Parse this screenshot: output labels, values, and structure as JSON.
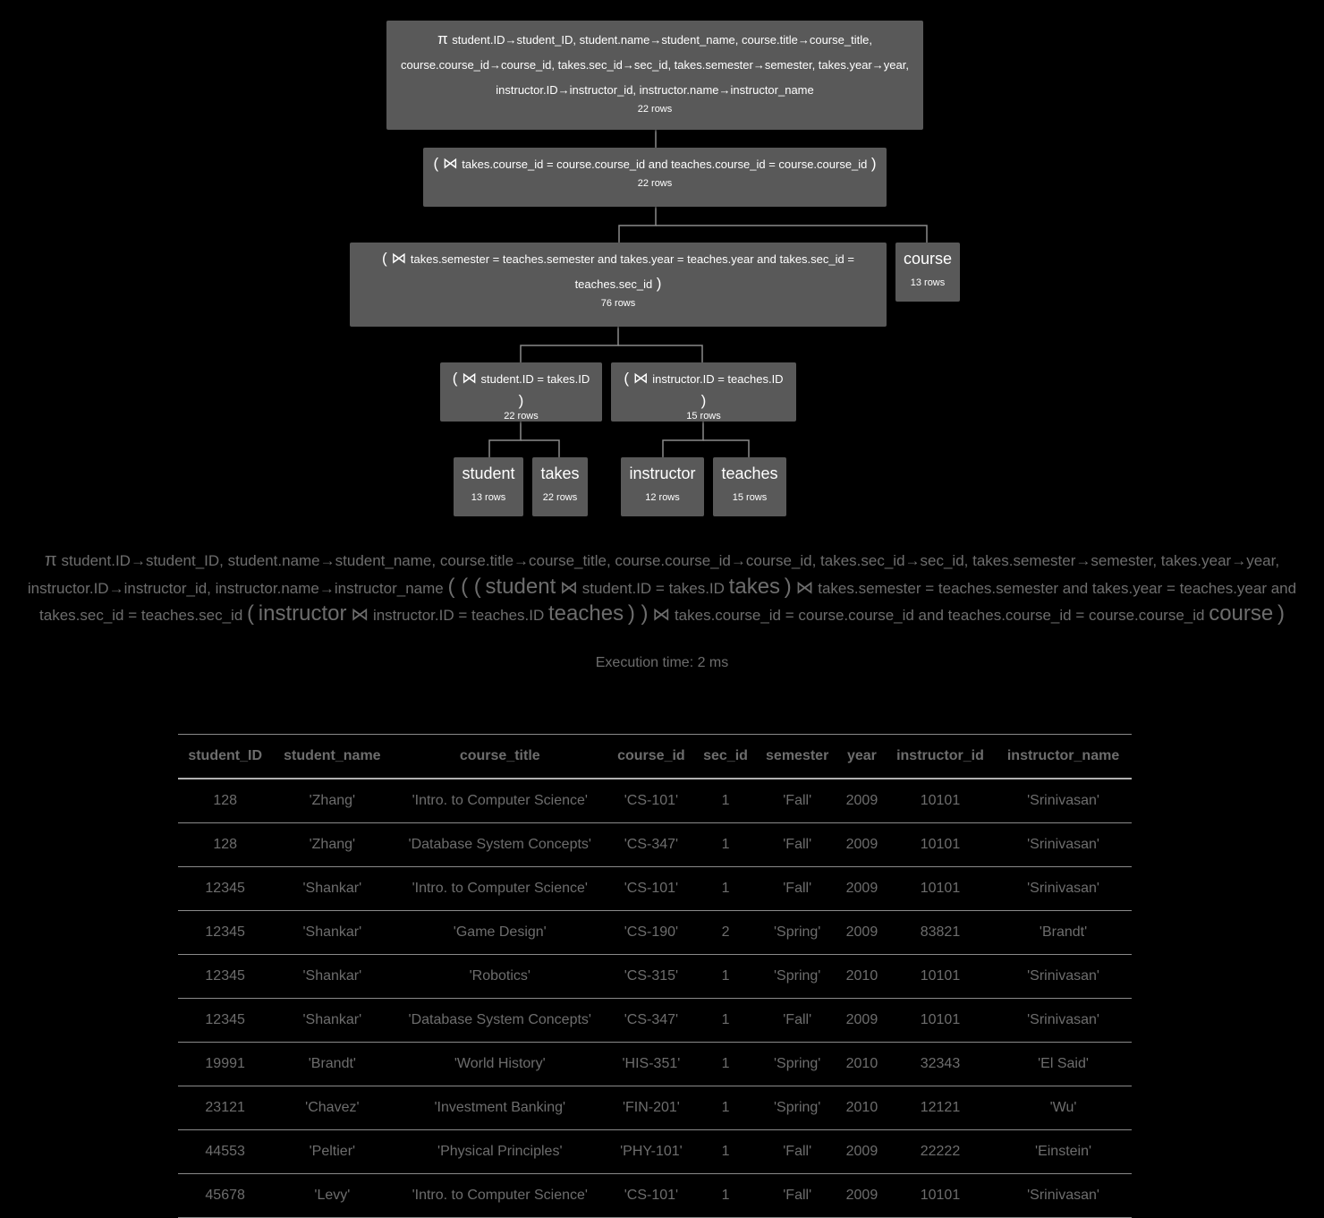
{
  "tree": {
    "projection": {
      "symbol": "π",
      "line1": "student.ID→student_ID, student.name→student_name, course.title→course_title,",
      "line2": "course.course_id→course_id, takes.sec_id→sec_id, takes.semester→semester, takes.year→year,",
      "line3": "instructor.ID→instructor_id, instructor.name→instructor_name",
      "rows": "22 rows"
    },
    "join_course": {
      "open": "( ⋈",
      "cond": "takes.course_id = course.course_id and teaches.course_id = course.course_id",
      "close": ")",
      "rows": "22 rows"
    },
    "join_sem": {
      "open": "( ⋈",
      "cond1": "takes.semester = teaches.semester and takes.year = teaches.year and takes.sec_id =",
      "cond2": "teaches.sec_id",
      "close": ")",
      "rows": "76 rows"
    },
    "course": {
      "name": "course",
      "rows": "13 rows"
    },
    "join_student": {
      "open": "( ⋈",
      "cond": "student.ID = takes.ID",
      "close": ")",
      "rows": "22 rows"
    },
    "join_instructor": {
      "open": "( ⋈",
      "cond": "instructor.ID = teaches.ID",
      "close": ")",
      "rows": "15 rows"
    },
    "student": {
      "name": "student",
      "rows": "13 rows"
    },
    "takes": {
      "name": "takes",
      "rows": "22 rows"
    },
    "instructor": {
      "name": "instructor",
      "rows": "12 rows"
    },
    "teaches": {
      "name": "teaches",
      "rows": "15 rows"
    }
  },
  "expression": {
    "pi": "π",
    "proj": "student.ID→student_ID, student.name→student_name, course.title→course_title, course.course_id→course_id, takes.sec_id→sec_id, takes.semester→semester, takes.year→year, instructor.ID→instructor_id, instructor.name→instructor_name",
    "open3": "( ( (",
    "student": "student",
    "join": "⋈",
    "cond_student": "student.ID = takes.ID",
    "takes": "takes",
    "close1": ")",
    "cond_sem": "takes.semester = teaches.semester and takes.year = teaches.year and takes.sec_id = teaches.sec_id",
    "open1": "(",
    "instructor": "instructor",
    "cond_instructor": "instructor.ID = teaches.ID",
    "teaches": "teaches",
    "close2": ") )",
    "cond_course": "takes.course_id = course.course_id and teaches.course_id = course.course_id",
    "course": "course",
    "close3": ")"
  },
  "execution": "Execution time: 2 ms",
  "table": {
    "columns": [
      "student_ID",
      "student_name",
      "course_title",
      "course_id",
      "sec_id",
      "semester",
      "year",
      "instructor_id",
      "instructor_name"
    ],
    "rows": [
      [
        "128",
        "'Zhang'",
        "'Intro. to Computer Science'",
        "'CS-101'",
        "1",
        "'Fall'",
        "2009",
        "10101",
        "'Srinivasan'"
      ],
      [
        "128",
        "'Zhang'",
        "'Database System Concepts'",
        "'CS-347'",
        "1",
        "'Fall'",
        "2009",
        "10101",
        "'Srinivasan'"
      ],
      [
        "12345",
        "'Shankar'",
        "'Intro. to Computer Science'",
        "'CS-101'",
        "1",
        "'Fall'",
        "2009",
        "10101",
        "'Srinivasan'"
      ],
      [
        "12345",
        "'Shankar'",
        "'Game Design'",
        "'CS-190'",
        "2",
        "'Spring'",
        "2009",
        "83821",
        "'Brandt'"
      ],
      [
        "12345",
        "'Shankar'",
        "'Robotics'",
        "'CS-315'",
        "1",
        "'Spring'",
        "2010",
        "10101",
        "'Srinivasan'"
      ],
      [
        "12345",
        "'Shankar'",
        "'Database System Concepts'",
        "'CS-347'",
        "1",
        "'Fall'",
        "2009",
        "10101",
        "'Srinivasan'"
      ],
      [
        "19991",
        "'Brandt'",
        "'World History'",
        "'HIS-351'",
        "1",
        "'Spring'",
        "2010",
        "32343",
        "'El Said'"
      ],
      [
        "23121",
        "'Chavez'",
        "'Investment Banking'",
        "'FIN-201'",
        "1",
        "'Spring'",
        "2010",
        "12121",
        "'Wu'"
      ],
      [
        "44553",
        "'Peltier'",
        "'Physical Principles'",
        "'PHY-101'",
        "1",
        "'Fall'",
        "2009",
        "22222",
        "'Einstein'"
      ],
      [
        "45678",
        "'Levy'",
        "'Intro. to Computer Science'",
        "'CS-101'",
        "1",
        "'Fall'",
        "2009",
        "10101",
        "'Srinivasan'"
      ]
    ]
  }
}
